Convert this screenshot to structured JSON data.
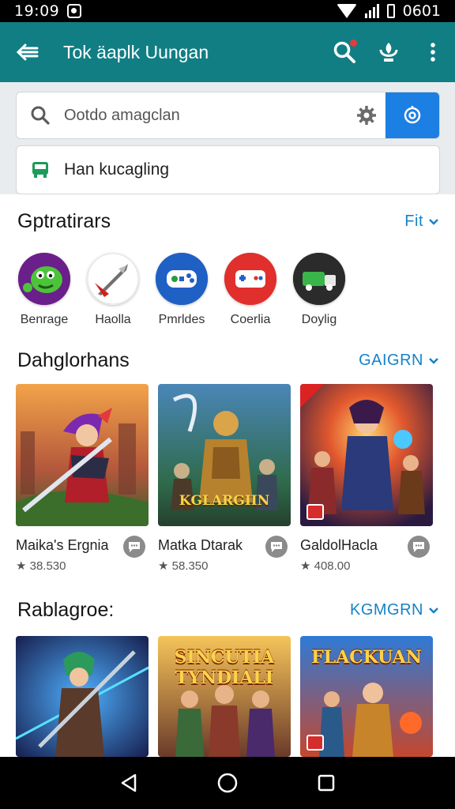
{
  "status": {
    "time": "19:09",
    "battery": "0601"
  },
  "app_bar": {
    "title": "Tok äaplk Uungan",
    "back_icon": "arrow-left-icon",
    "search_icon": "search-icon",
    "mic_icon": "microphone-icon",
    "menu_icon": "more-vert-icon"
  },
  "search": {
    "placeholder": "Ootdo amagclan",
    "settings_icon": "gear-icon",
    "go_icon": "camera-search-icon"
  },
  "chip": {
    "label": "Han kucagling",
    "icon": "bus-icon"
  },
  "categories_section": {
    "title": "Gptratirars",
    "more": "Fit",
    "items": [
      {
        "label": "Benrage",
        "color": "#3a8f2a"
      },
      {
        "label": "Haolla",
        "color": "#ffffff"
      },
      {
        "label": "Pmrldes",
        "color": "#2563c9"
      },
      {
        "label": "Coerlia",
        "color": "#e4312f"
      },
      {
        "label": "Doylig",
        "color": "#2f2f2f"
      }
    ]
  },
  "featured_section": {
    "title": "Dahglorhans",
    "more": "GAIGRN",
    "cards": [
      {
        "name": "Maika's Ergnia",
        "rating": "★ 38.530"
      },
      {
        "name": "Matka Dtarak",
        "rating": "★ 58.350",
        "art_title": "KGLARGIIN"
      },
      {
        "name": "GaldolHacla",
        "rating": "★ 408.00"
      }
    ]
  },
  "second_section": {
    "title": "Rablagroe:",
    "more": "KGMGRN",
    "cards": [
      {
        "art_title": ""
      },
      {
        "art_title": "SINCUTIA TYNDIALI"
      },
      {
        "art_title": "FLACKUAN"
      }
    ]
  },
  "colors": {
    "app_bar": "#117e84",
    "accent": "#1683c8",
    "search_button": "#1b7fe3"
  }
}
